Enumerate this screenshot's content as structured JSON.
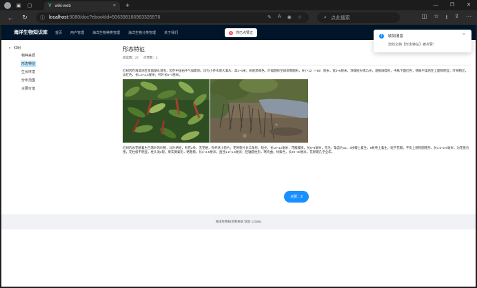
{
  "browser": {
    "tab_title": "wiki-web",
    "tab_close": "×",
    "new_tab": "+",
    "url_host": "localhost",
    "url_path": ":8080/doc?ebookId=506398166963326976",
    "search_placeholder": "点此搜索",
    "window_controls": [
      "—",
      "❐",
      "✕"
    ]
  },
  "app": {
    "brand": "海洋生物知识库",
    "menu": [
      "首页",
      "用户管理",
      "海洋生物种类管理",
      "海洋生物分类管理",
      "关于我们"
    ]
  },
  "toast": {
    "text": "你已点赞过"
  },
  "notification": {
    "title": "收到消息",
    "description": "您的文档【形态特征】被点赞！",
    "close": "×"
  },
  "tree": {
    "root": "红树",
    "children": [
      "物种来源",
      "形态特征",
      "生长环境",
      "分布范围",
      "主要价值"
    ],
    "selected_index": 1
  },
  "doc": {
    "title": "形态特征",
    "read_label": "阅读数：27",
    "vote_label": "点赞数：2",
    "para1": "红树因在海滨地区多面潮水浸泡，但在中国由于气候影响，均为小乔木或大灌木，高2~4米；树皮黑褐色。叶幅圆形至阔状椭圆形，长7~12（~16）厘米，宽3~6厘米，顶端短尖或凸尖，基部阔楔形，中脉下面红色，侧脉干燥后在上面稍明显；叶柄粗壮，淡红色，长1.5~2.5厘米；托叶长5~7厘米。",
    "para2": "红树的总花梗着生已落叶的叶腋，比叶柄短，有花2朵；无花梗，有杯状小苞片；花萼裂片长三角形，短尖，长10~12毫米；花瓣膜质，长6~8毫米，无毛；雄蕊约12，4枚瓣上着生，8枚萼上着生，短于花瓣；子房上部钝圆锥形，长1.5~2.5毫米，为花盘包围，花柱极不明显，柱头浅2裂。果实倒梨形，略粗糙，长2~2.5厘米，直径1.2~1.5厘米；胚轴圆柱形，略弯曲，绿紫色，长20~40厘米。花果期几乎全年。",
    "vote_button": "点赞：2"
  },
  "footer": {
    "text": "海洋生物知识库系统 欢迎 123abc"
  },
  "colors": {
    "header_bg": "#001529",
    "primary": "#1890ff",
    "selected_bg": "#bae7ff",
    "error": "#ff4d4f"
  }
}
